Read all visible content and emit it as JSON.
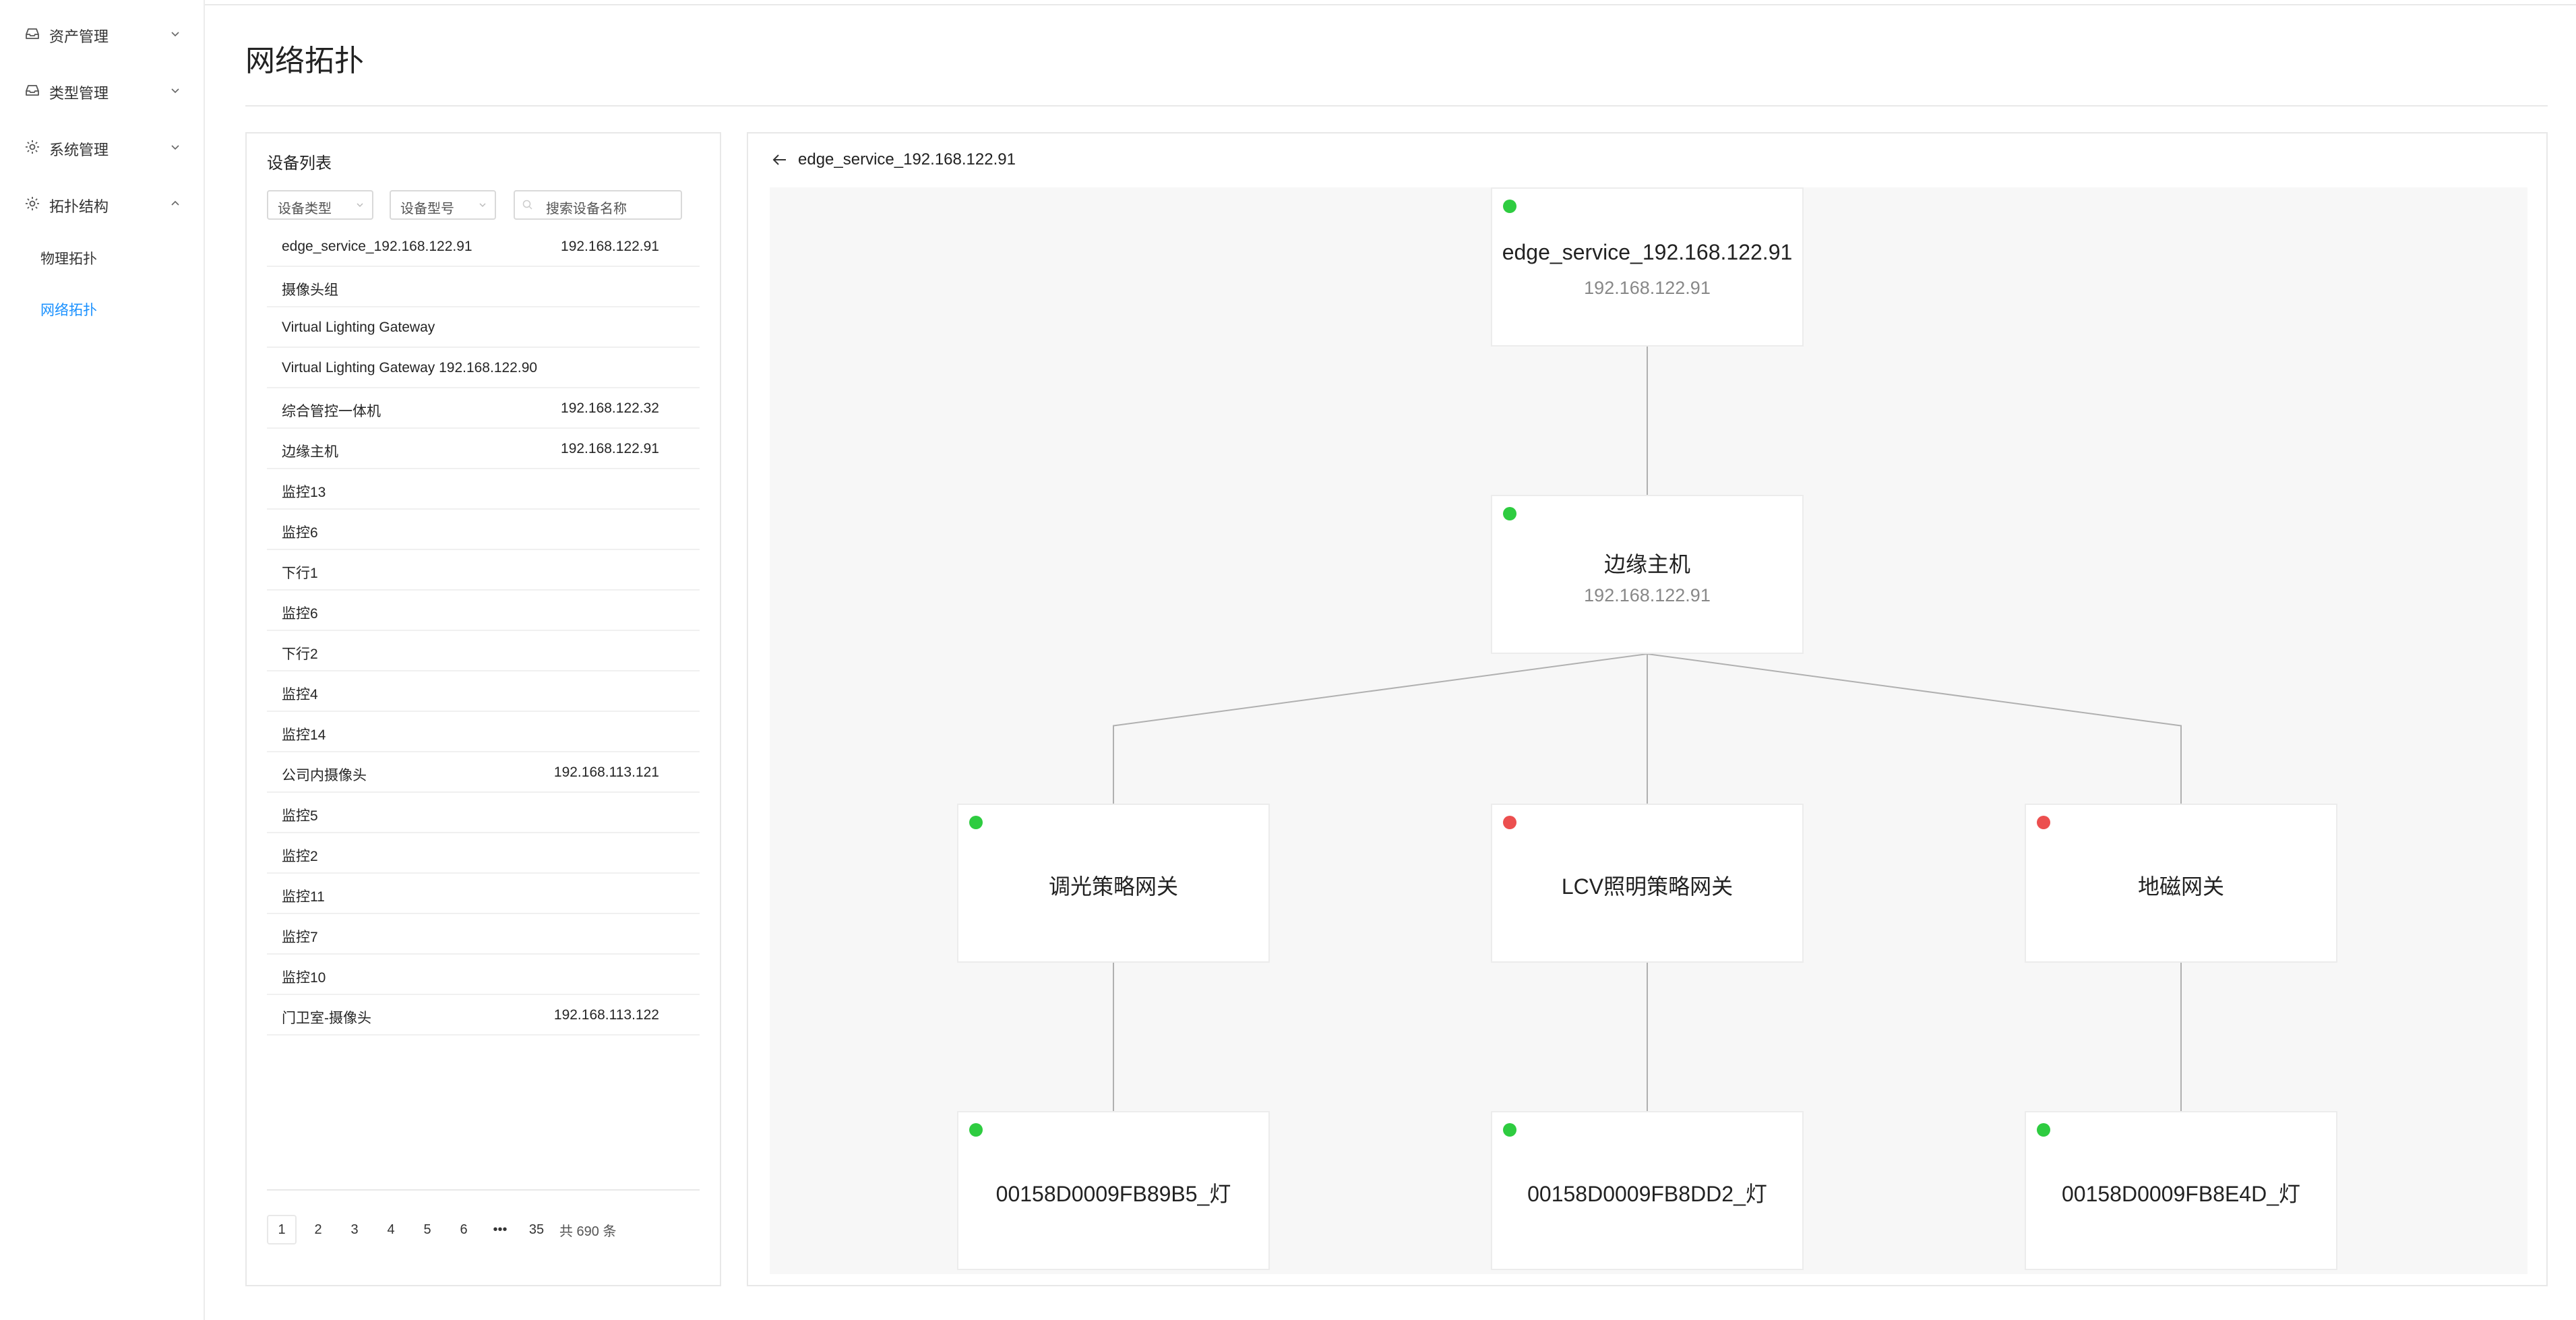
{
  "sidebar": {
    "menus": [
      {
        "label": "资产管理",
        "icon": "inbox-icon",
        "expanded": false
      },
      {
        "label": "类型管理",
        "icon": "inbox-icon",
        "expanded": false
      },
      {
        "label": "系统管理",
        "icon": "gear-icon",
        "expanded": false
      },
      {
        "label": "拓扑结构",
        "icon": "gear-icon",
        "expanded": true
      }
    ],
    "submenu": [
      {
        "label": "物理拓扑",
        "active": false
      },
      {
        "label": "网络拓扑",
        "active": true
      }
    ]
  },
  "header": {
    "title": "网络拓扑"
  },
  "device_panel": {
    "title": "设备列表",
    "filters": {
      "device_type": "设备类型",
      "device_model": "设备型号",
      "search_placeholder": "搜索设备名称"
    },
    "rows": [
      {
        "name": "edge_service_192.168.122.91",
        "ip": "192.168.122.91"
      },
      {
        "name": "摄像头组",
        "ip": ""
      },
      {
        "name": "Virtual Lighting Gateway",
        "ip": ""
      },
      {
        "name": "Virtual Lighting Gateway 192.168.122.90",
        "ip": ""
      },
      {
        "name": "综合管控一体机",
        "ip": "192.168.122.32"
      },
      {
        "name": "边缘主机",
        "ip": "192.168.122.91"
      },
      {
        "name": "监控13",
        "ip": ""
      },
      {
        "name": "监控6",
        "ip": ""
      },
      {
        "name": "下行1",
        "ip": ""
      },
      {
        "name": "监控6",
        "ip": ""
      },
      {
        "name": "下行2",
        "ip": ""
      },
      {
        "name": "监控4",
        "ip": ""
      },
      {
        "name": "监控14",
        "ip": ""
      },
      {
        "name": "公司内摄像头",
        "ip": "192.168.113.121"
      },
      {
        "name": "监控5",
        "ip": ""
      },
      {
        "name": "监控2",
        "ip": ""
      },
      {
        "name": "监控11",
        "ip": ""
      },
      {
        "name": "监控7",
        "ip": ""
      },
      {
        "name": "监控10",
        "ip": ""
      },
      {
        "name": "门卫室-摄像头",
        "ip": "192.168.113.122"
      }
    ],
    "pagination": {
      "pages": [
        "1",
        "2",
        "3",
        "4",
        "5",
        "6",
        "•••",
        "35"
      ],
      "current": "1",
      "total_text": "共 690 条"
    }
  },
  "topology": {
    "back_label": "edge_service_192.168.122.91",
    "status_colors": {
      "online": "#2ecc40",
      "offline": "#ec4f4f"
    },
    "nodes": [
      {
        "id": "root",
        "name": "edge_service_192.168.122.91",
        "ip": "192.168.122.91",
        "status": "online"
      },
      {
        "id": "host",
        "name": "边缘主机",
        "ip": "192.168.122.91",
        "status": "online"
      },
      {
        "id": "gw1",
        "name": "调光策略网关",
        "ip": "",
        "status": "online"
      },
      {
        "id": "gw2",
        "name": "LCV照明策略网关",
        "ip": "",
        "status": "offline"
      },
      {
        "id": "gw3",
        "name": "地磁网关",
        "ip": "",
        "status": "offline"
      },
      {
        "id": "lamp1",
        "name": "00158D0009FB89B5_灯",
        "ip": "",
        "status": "online"
      },
      {
        "id": "lamp2",
        "name": "00158D0009FB8DD2_灯",
        "ip": "",
        "status": "online"
      },
      {
        "id": "lamp3",
        "name": "00158D0009FB8E4D_灯",
        "ip": "",
        "status": "online"
      }
    ],
    "edges": [
      [
        "root",
        "host"
      ],
      [
        "host",
        "gw1"
      ],
      [
        "host",
        "gw2"
      ],
      [
        "host",
        "gw3"
      ],
      [
        "gw1",
        "lamp1"
      ],
      [
        "gw2",
        "lamp2"
      ],
      [
        "gw3",
        "lamp3"
      ]
    ]
  }
}
